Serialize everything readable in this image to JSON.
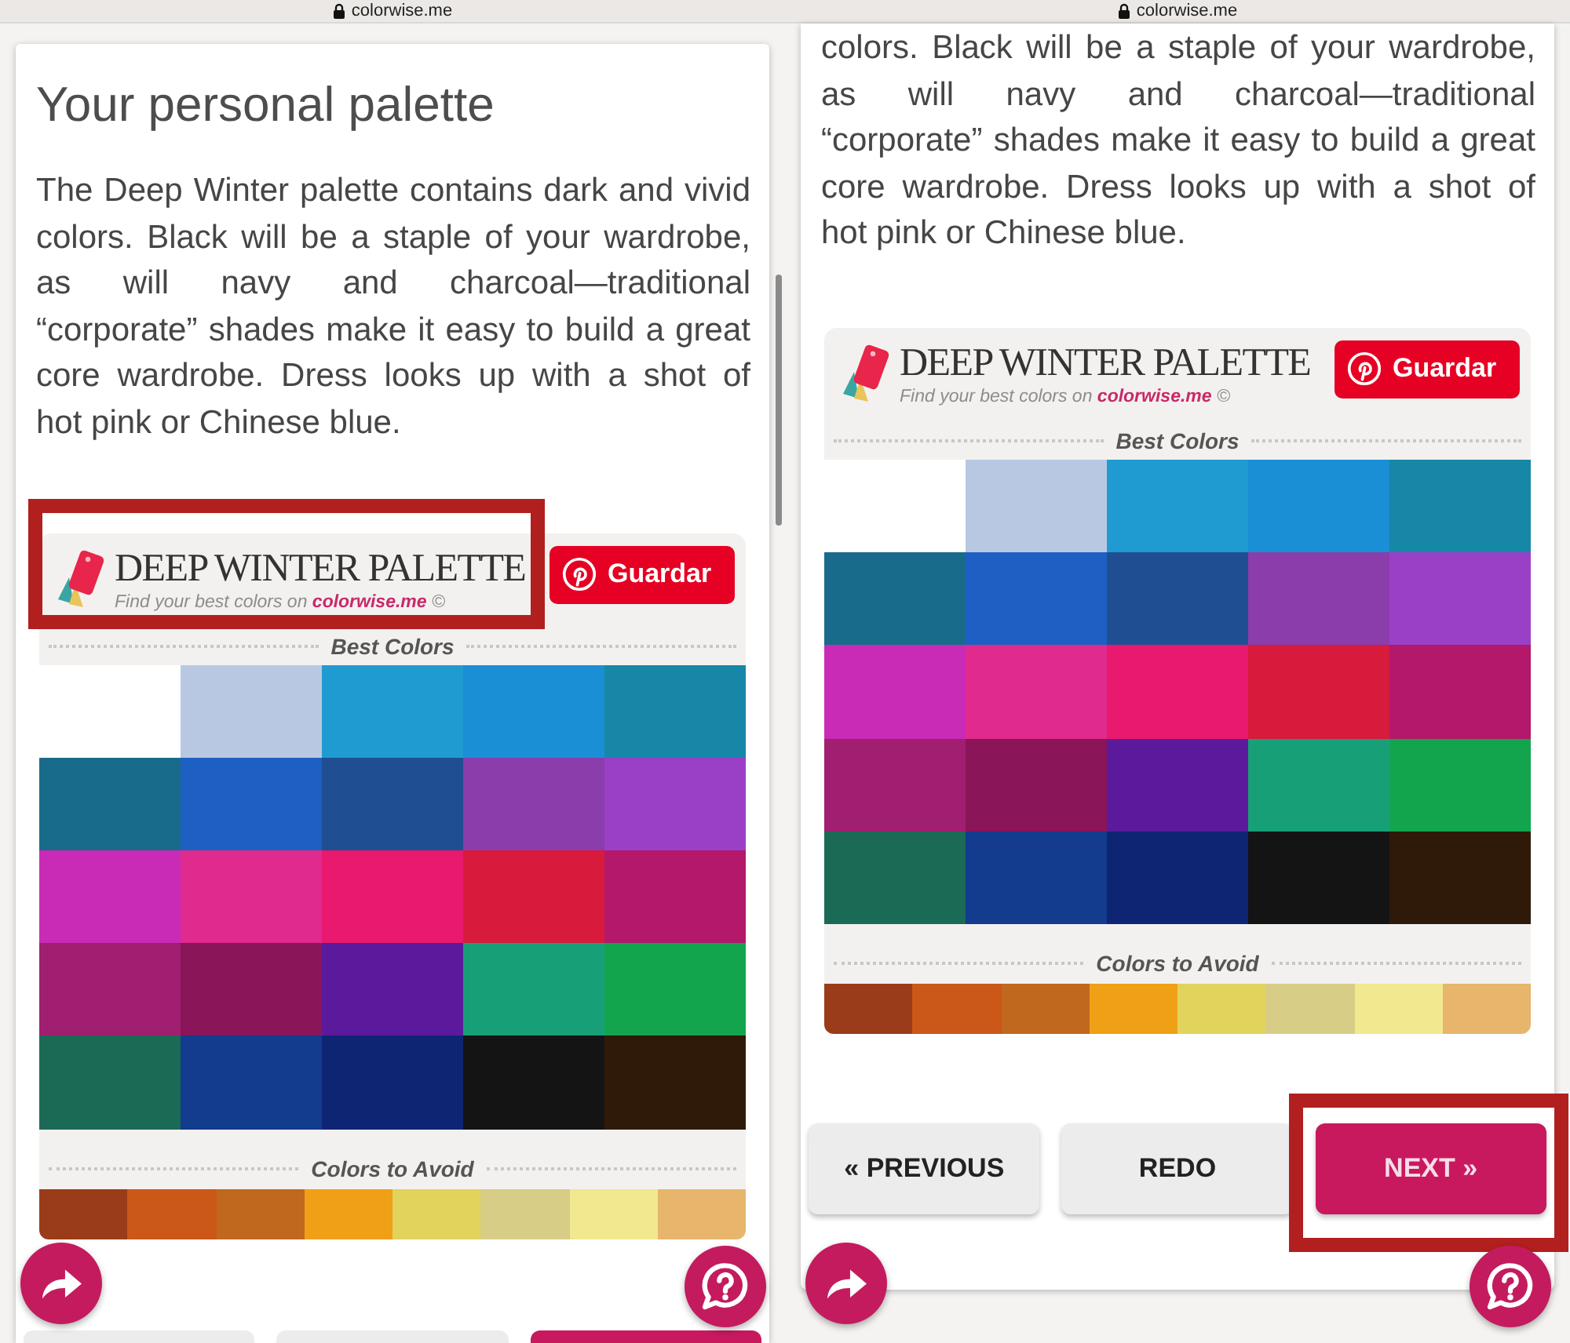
{
  "panels": [
    {
      "address_bar": {
        "url": "colorwise.me"
      },
      "title": "Your personal palette",
      "description_lines": [
        "The Deep Winter palette contains dark and vivid",
        "colors. Black will be a staple of your wardrobe,",
        "as will navy and charcoal—traditional",
        "“corporate” shades make it easy to build a great",
        "core wardrobe. Dress looks up with a shot of",
        "hot pink or Chinese blue."
      ],
      "scrollbar": true,
      "palette_card": {
        "highlighted": true,
        "title": "DEEP WINTER PALETTE",
        "tagline": "Find your best colors on **colorwise.me** ©",
        "save_button": "Guardar",
        "best_label": "Best Colors",
        "best_colors": [
          {
            "color": "#ffffff"
          },
          {
            "color": "#b8c8e2"
          },
          {
            "color": "#1f9bd2"
          },
          {
            "color": "#1a8fd6"
          },
          {
            "color": "#1787a8"
          },
          {
            "color": "#196b8c"
          },
          {
            "color": "#1e5fc3"
          },
          {
            "color": "#1f4e92"
          },
          {
            "color": "#8b3dac"
          },
          {
            "color": "#9a40c6"
          },
          {
            "color": "#c92bb6"
          },
          {
            "color": "#e02a8d"
          },
          {
            "color": "#e8196e"
          },
          {
            "color": "#d81a3c"
          },
          {
            "color": "#b3186a"
          },
          {
            "color": "#a01f70"
          },
          {
            "color": "#8a1558"
          },
          {
            "color": "#5b1a9c"
          },
          {
            "color": "#17a078"
          },
          {
            "color": "#12a54e"
          },
          {
            "color": "#1b6a56"
          },
          {
            "color": "#133b8e"
          },
          {
            "color": "#0e2574"
          },
          {
            "color": "#141414"
          },
          {
            "color": "#2f1a0a"
          }
        ],
        "avoid_label": "Colors to Avoid",
        "avoid_colors": [
          {
            "color": "#9a3c1a"
          },
          {
            "color": "#cb5719"
          },
          {
            "color": "#c0681e"
          },
          {
            "color": "#f0a017"
          },
          {
            "color": "#e2d35c"
          },
          {
            "color": "#d8cd86"
          },
          {
            "color": "#f1e88f"
          },
          {
            "color": "#e7b56b"
          }
        ]
      },
      "nav_buttons": [
        {
          "primary": false,
          "highlighted": false
        },
        {
          "primary": false,
          "highlighted": false
        },
        {
          "primary": true,
          "highlighted": false
        }
      ]
    },
    {
      "address_bar": {
        "url": "colorwise.me"
      },
      "description_lines": [
        "colors. Black will be a staple of your wardrobe,",
        "as will navy and charcoal—traditional",
        "“corporate” shades make it easy to build a great",
        "core wardrobe. Dress looks up with a shot of",
        "hot pink or Chinese blue."
      ],
      "palette_card": {
        "highlighted": false,
        "title": "DEEP WINTER PALETTE",
        "tagline": "Find your best colors on **colorwise.me** ©",
        "save_button": "Guardar",
        "best_label": "Best Colors",
        "best_colors": [
          {
            "color": "#ffffff"
          },
          {
            "color": "#b8c8e2"
          },
          {
            "color": "#1f9bd2"
          },
          {
            "color": "#1a8fd6"
          },
          {
            "color": "#1787a8"
          },
          {
            "color": "#196b8c"
          },
          {
            "color": "#1e5fc3"
          },
          {
            "color": "#1f4e92"
          },
          {
            "color": "#8b3dac"
          },
          {
            "color": "#9a40c6"
          },
          {
            "color": "#c92bb6"
          },
          {
            "color": "#e02a8d"
          },
          {
            "color": "#e8196e"
          },
          {
            "color": "#d81a3c"
          },
          {
            "color": "#b3186a"
          },
          {
            "color": "#a01f70"
          },
          {
            "color": "#8a1558"
          },
          {
            "color": "#5b1a9c"
          },
          {
            "color": "#17a078"
          },
          {
            "color": "#12a54e"
          },
          {
            "color": "#1b6a56"
          },
          {
            "color": "#133b8e"
          },
          {
            "color": "#0e2574"
          },
          {
            "color": "#141414"
          },
          {
            "color": "#2f1a0a"
          }
        ],
        "avoid_label": "Colors to Avoid",
        "avoid_colors": [
          {
            "color": "#9a3c1a"
          },
          {
            "color": "#cb5719"
          },
          {
            "color": "#c0681e"
          },
          {
            "color": "#f0a017"
          },
          {
            "color": "#e2d35c"
          },
          {
            "color": "#d8cd86"
          },
          {
            "color": "#f1e88f"
          },
          {
            "color": "#e7b56b"
          }
        ]
      },
      "nav_buttons": [
        {
          "label": "« PREVIOUS",
          "primary": false,
          "highlighted": false
        },
        {
          "label": "REDO",
          "primary": false,
          "highlighted": false
        },
        {
          "label": "NEXT »",
          "primary": true,
          "highlighted": true
        }
      ]
    }
  ]
}
